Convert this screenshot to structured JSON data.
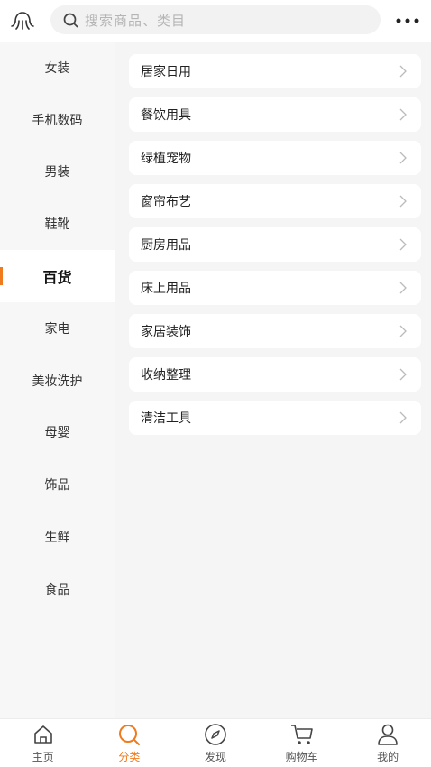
{
  "header": {
    "search_placeholder": "搜索商品、类目",
    "logo_icon": "octopus-logo-icon",
    "more_icon": "more-dots-icon"
  },
  "colors": {
    "accent": "#f07b1e",
    "text": "#222222",
    "muted": "#b5b5b5"
  },
  "sidebar": {
    "items": [
      {
        "label": "女装",
        "active": false
      },
      {
        "label": "手机数码",
        "active": false
      },
      {
        "label": "男装",
        "active": false
      },
      {
        "label": "鞋靴",
        "active": false
      },
      {
        "label": "百货",
        "active": true
      },
      {
        "label": "家电",
        "active": false
      },
      {
        "label": "美妆洗护",
        "active": false
      },
      {
        "label": "母婴",
        "active": false
      },
      {
        "label": "饰品",
        "active": false
      },
      {
        "label": "生鲜",
        "active": false
      },
      {
        "label": "食品",
        "active": false
      }
    ]
  },
  "categories": [
    "居家日用",
    "餐饮用具",
    "绿植宠物",
    "窗帘布艺",
    "厨房用品",
    "床上用品",
    "家居装饰",
    "收纳整理",
    "清洁工具"
  ],
  "tabbar": {
    "items": [
      {
        "label": "主页",
        "icon": "home-icon",
        "active": false
      },
      {
        "label": "分类",
        "icon": "category-search-icon",
        "active": true
      },
      {
        "label": "发现",
        "icon": "compass-icon",
        "active": false
      },
      {
        "label": "购物车",
        "icon": "cart-icon",
        "active": false
      },
      {
        "label": "我的",
        "icon": "user-icon",
        "active": false
      }
    ]
  }
}
